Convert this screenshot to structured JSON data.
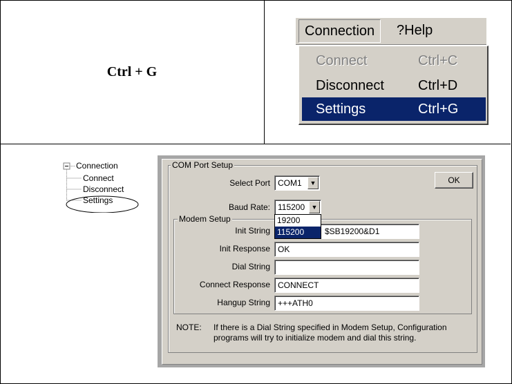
{
  "shortcut": "Ctrl + G",
  "menubar": {
    "connection": "Connection",
    "help": "?Help"
  },
  "menu": {
    "items": [
      {
        "label": "Connect",
        "shortcut": "Ctrl+C"
      },
      {
        "label": "Disconnect",
        "shortcut": "Ctrl+D"
      },
      {
        "label": "Settings",
        "shortcut": "Ctrl+G"
      }
    ]
  },
  "tree": {
    "root": "Connection",
    "children": [
      "Connect",
      "Disconnect",
      "Settings"
    ]
  },
  "com_setup": {
    "group_title": "COM Port Setup",
    "select_port_label": "Select Port",
    "select_port_value": "COM1",
    "baud_rate_label": "Baud Rate:",
    "baud_rate_value": "115200",
    "baud_options": [
      "19200",
      "115200"
    ],
    "ok_label": "OK"
  },
  "modem_setup": {
    "group_title": "Modem Setup",
    "init_string_label": "Init String",
    "init_string_value": "$SB19200&D1",
    "init_response_label": "Init Response",
    "init_response_value": "OK",
    "dial_string_label": "Dial String",
    "dial_string_value": "",
    "connect_response_label": "Connect Response",
    "connect_response_value": "CONNECT",
    "hangup_string_label": "Hangup String",
    "hangup_string_value": "+++ATH0"
  },
  "note": {
    "prefix": "NOTE:",
    "line1": "If there is a Dial String specified in Modem Setup, Configuration",
    "line2": "programs will try to initialize modem and dial this string."
  }
}
